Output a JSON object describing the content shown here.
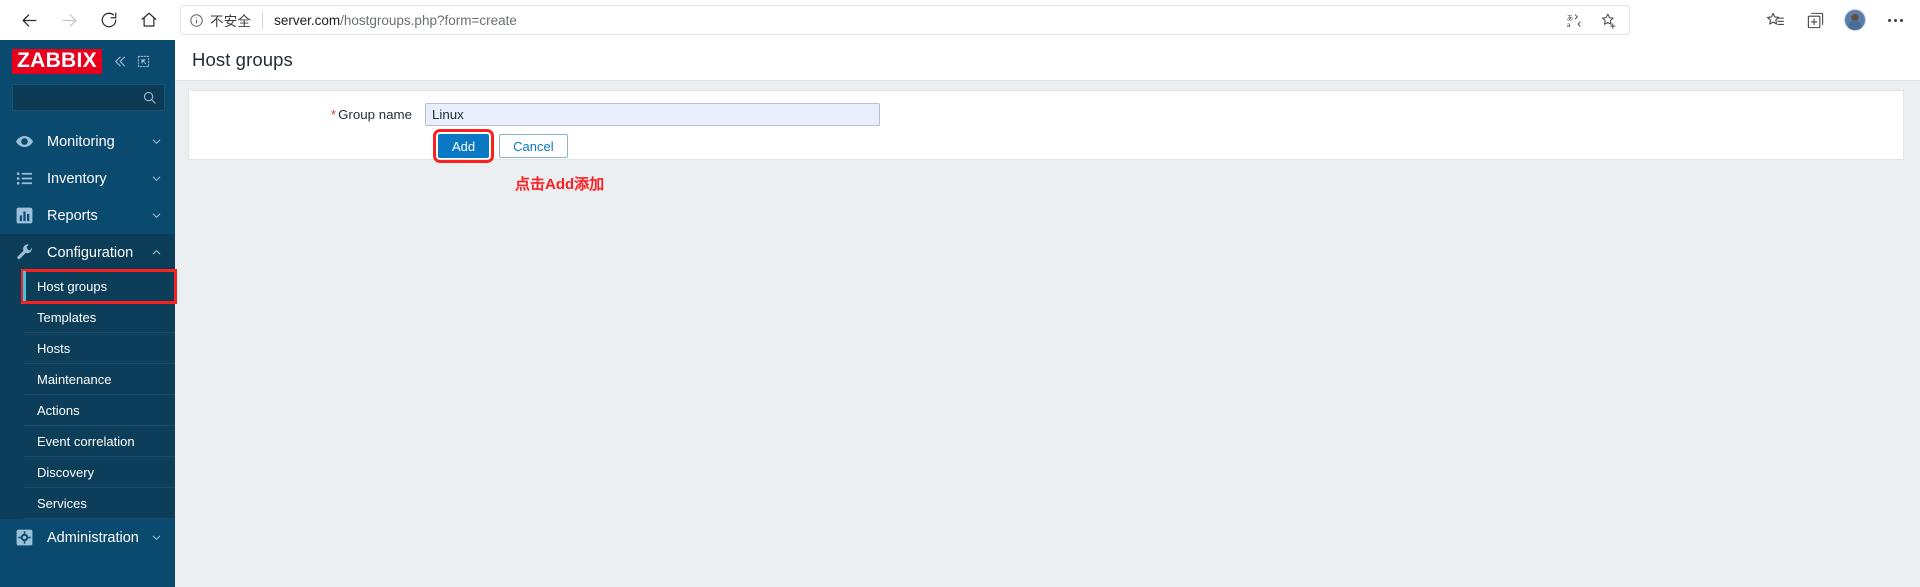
{
  "browser": {
    "nav": {
      "back": "back-arrow",
      "forward": "forward-arrow",
      "reload": "reload",
      "home": "home"
    },
    "address": {
      "info_icon": "info-circle-icon",
      "security_label": "不安全",
      "url_main": "server.com",
      "url_path": "/hostgroups.php?form=create",
      "translate_icon": "translate-icon",
      "favorite_icon": "star-add-icon"
    },
    "toolbar": {
      "collections_icon": "collections-star-icon",
      "split_screen_icon": "split-screen-icon",
      "profile_icon": "avatar",
      "more_icon": "more-dots-icon"
    }
  },
  "sidebar": {
    "logo": "ZABBIX",
    "collapse_icon": "chevron-double-left-icon",
    "compact_icon": "collapse-sidebar-icon",
    "search_placeholder": "",
    "search_icon": "search-icon",
    "items": [
      {
        "label": "Monitoring",
        "icon": "eye-icon",
        "expanded": false,
        "chevron": "chevron-down-icon"
      },
      {
        "label": "Inventory",
        "icon": "list-icon",
        "expanded": false,
        "chevron": "chevron-down-icon"
      },
      {
        "label": "Reports",
        "icon": "bar-chart-icon",
        "expanded": false,
        "chevron": "chevron-down-icon"
      },
      {
        "label": "Configuration",
        "icon": "wrench-icon",
        "expanded": true,
        "chevron": "chevron-up-icon"
      },
      {
        "label": "Administration",
        "icon": "gear-icon",
        "expanded": false,
        "chevron": "chevron-down-icon"
      }
    ],
    "configuration_submenu": [
      {
        "label": "Host groups",
        "active": true,
        "annotated": true
      },
      {
        "label": "Templates",
        "active": false,
        "annotated": false
      },
      {
        "label": "Hosts",
        "active": false,
        "annotated": false
      },
      {
        "label": "Maintenance",
        "active": false,
        "annotated": false
      },
      {
        "label": "Actions",
        "active": false,
        "annotated": false
      },
      {
        "label": "Event correlation",
        "active": false,
        "annotated": false
      },
      {
        "label": "Discovery",
        "active": false,
        "annotated": false
      },
      {
        "label": "Services",
        "active": false,
        "annotated": false
      }
    ]
  },
  "main": {
    "page_title": "Host groups",
    "form": {
      "required_marker": "*",
      "group_name_label": "Group name",
      "group_name_value": "Linux",
      "group_name_placeholder": "",
      "add_button": "Add",
      "cancel_button": "Cancel"
    },
    "annotation": "点击Add添加"
  },
  "colors": {
    "zabbix_red": "#e8001c",
    "sidebar_blue": "#0a4a6e",
    "primary_button": "#0a78c2",
    "annotation_red": "#fb2020",
    "accent_cyan": "#3ec6e0"
  }
}
